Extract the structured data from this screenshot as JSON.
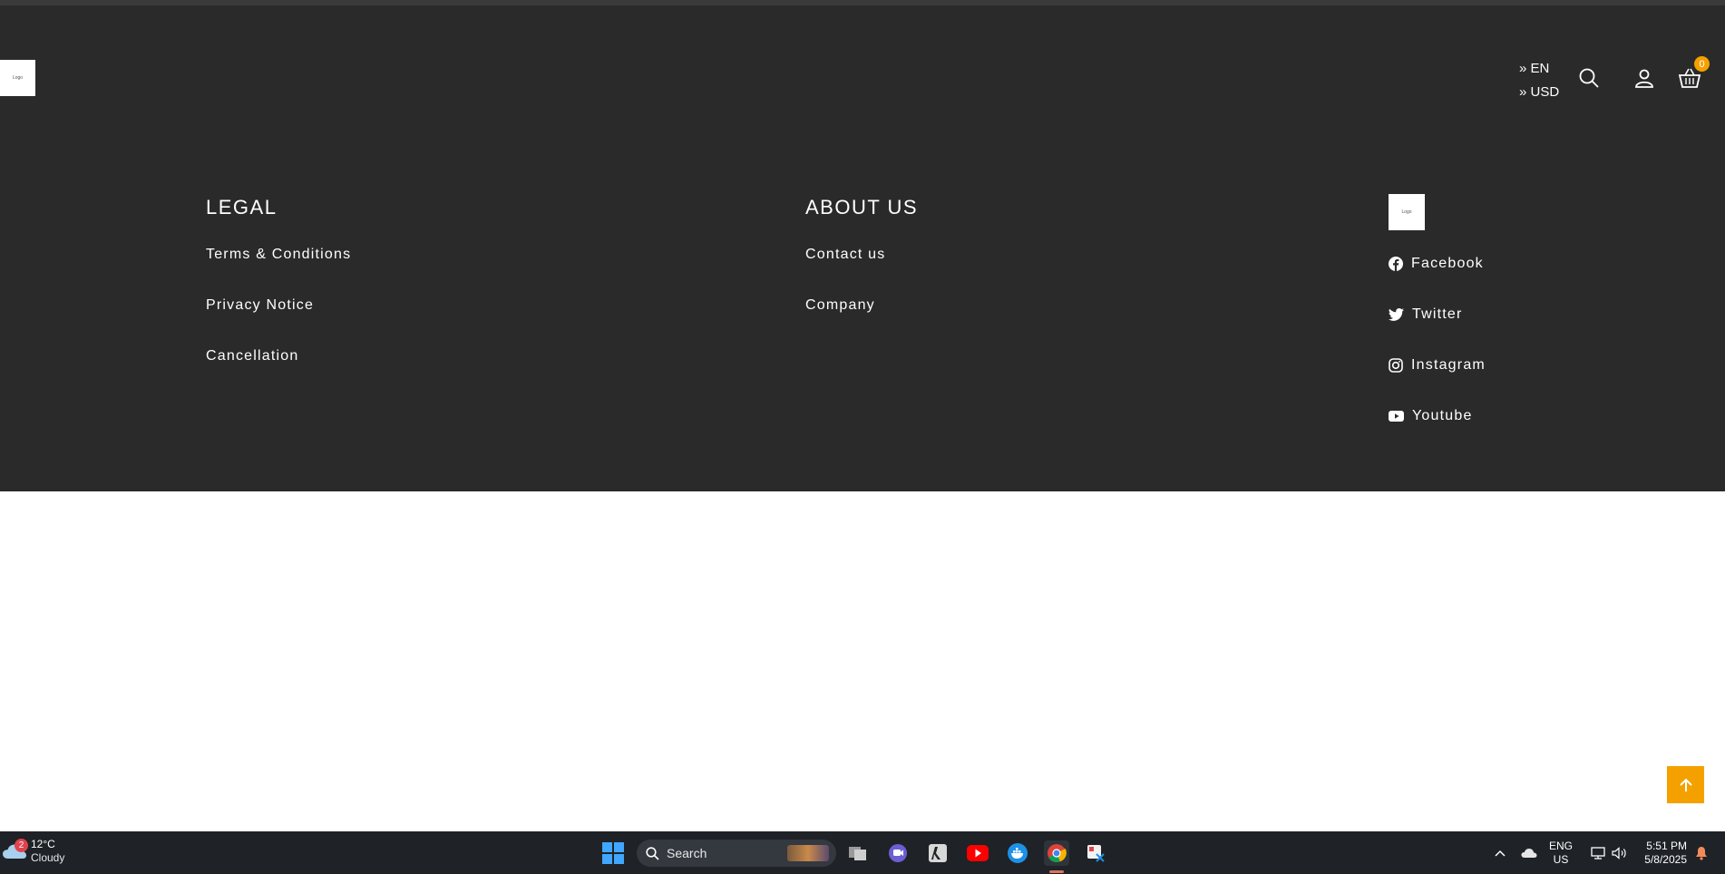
{
  "header": {
    "logo_text": "Logo",
    "language": "» EN",
    "currency": "» USD",
    "search_icon": "search-icon",
    "user_icon": "user-icon",
    "cart_icon": "basket-icon",
    "cart_count": "0"
  },
  "footer": {
    "legal": {
      "title": "LEGAL",
      "links": [
        "Terms & Conditions",
        "Privacy Notice",
        "Cancellation"
      ]
    },
    "about": {
      "title": "ABOUT US",
      "links": [
        "Contact us",
        "Company"
      ]
    },
    "social": {
      "logo_text": "Logo",
      "links": [
        {
          "label": "Facebook",
          "icon": "facebook-icon"
        },
        {
          "label": "Twitter",
          "icon": "twitter-icon"
        },
        {
          "label": "Instagram",
          "icon": "instagram-icon"
        },
        {
          "label": "Youtube",
          "icon": "youtube-icon"
        }
      ]
    }
  },
  "scroll_top": {
    "icon": "arrow-up-icon"
  },
  "taskbar": {
    "weather": {
      "temperature": "12°C",
      "condition": "Cloudy",
      "badge": "2"
    },
    "search_label": "Search",
    "language": {
      "line1": "ENG",
      "line2": "US"
    },
    "clock": {
      "time": "5:51 PM",
      "date": "5/8/2025"
    }
  },
  "colors": {
    "dark_bg": "#2a2a2a",
    "accent": "#f4a100",
    "taskbar_bg": "#1f2227"
  }
}
